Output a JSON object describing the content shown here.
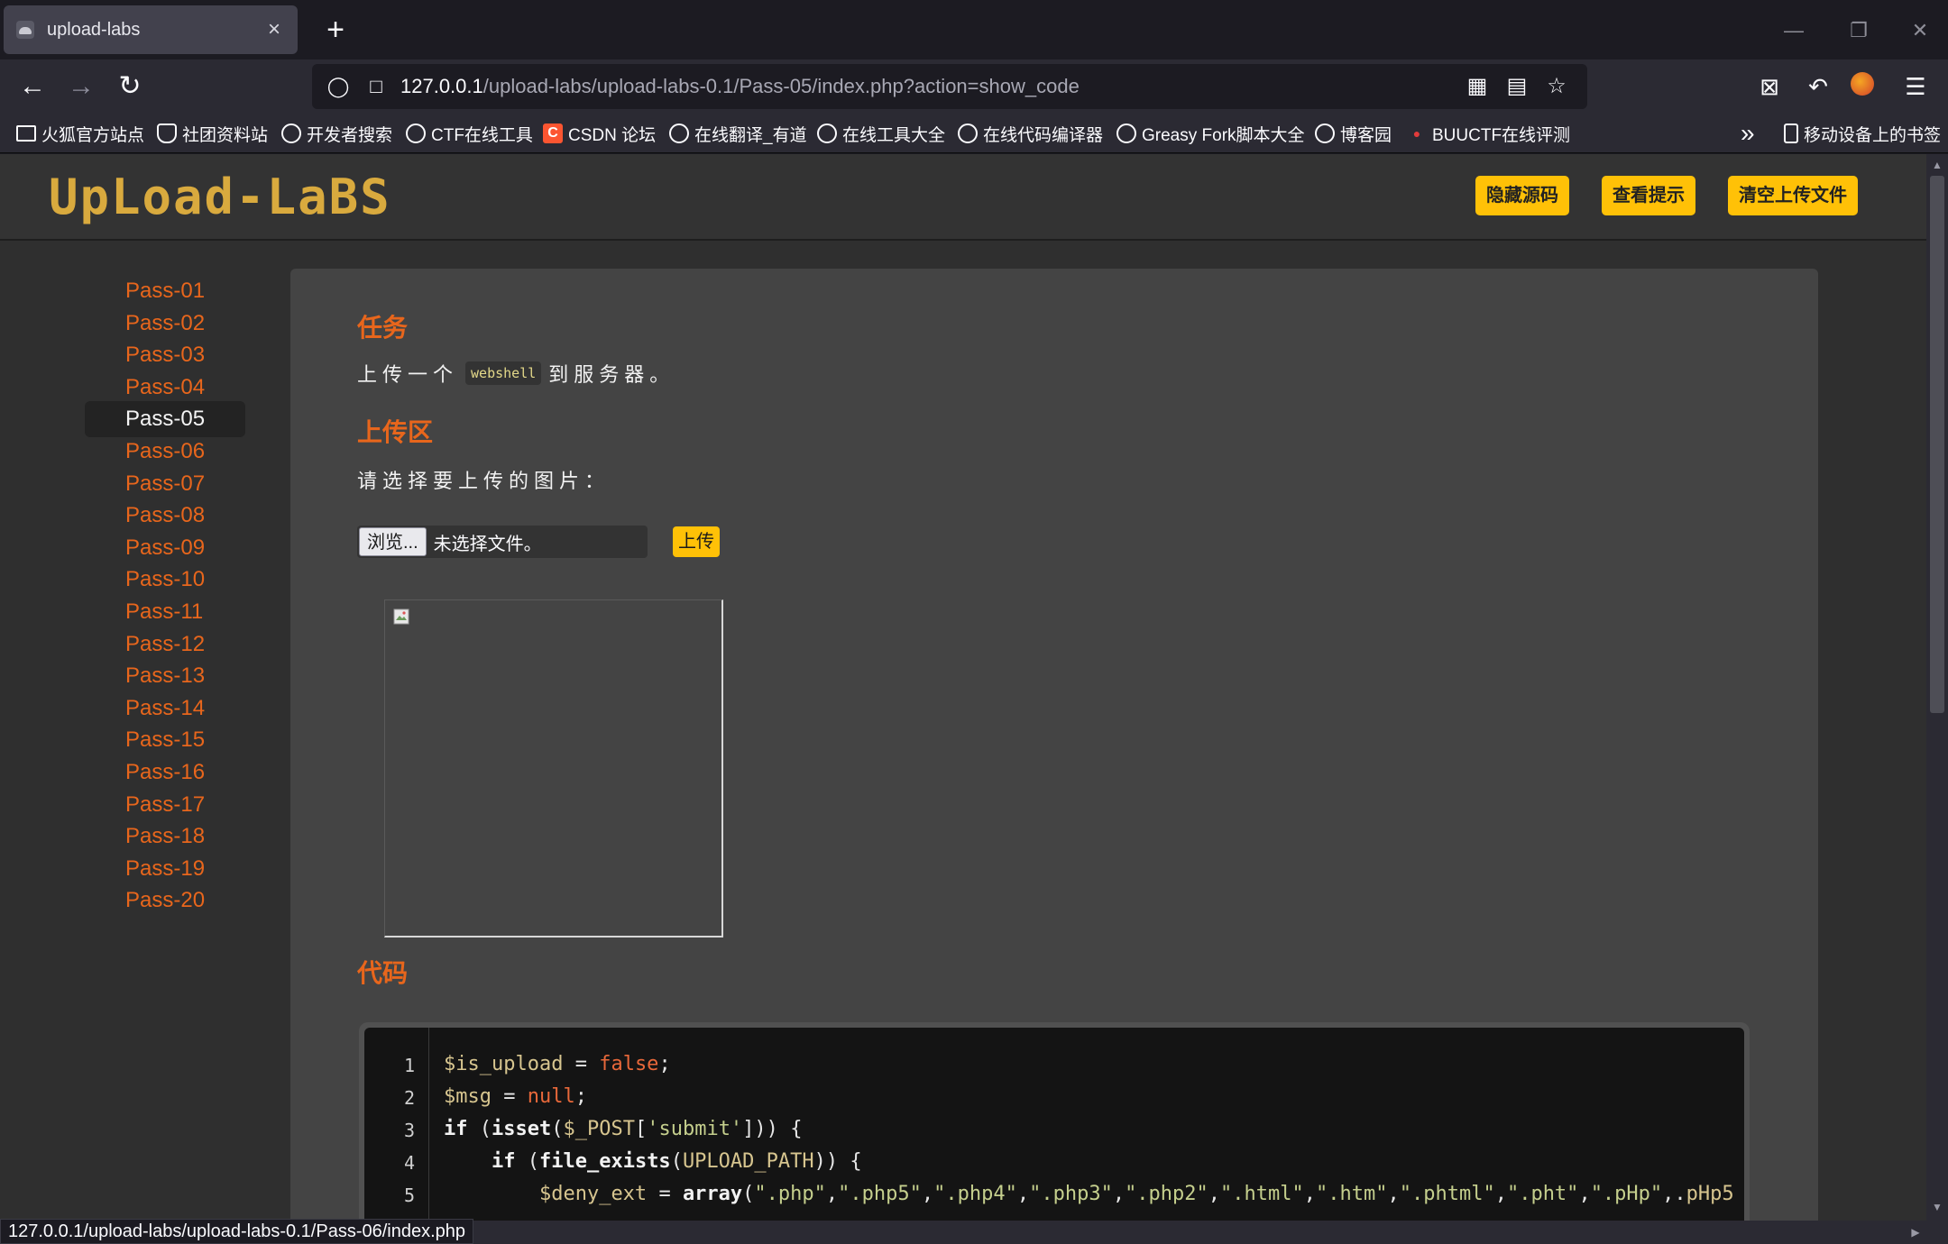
{
  "browser": {
    "tab_title": "upload-labs",
    "tab_close": "×",
    "new_tab": "+",
    "url_host": "127.0.0.1",
    "url_path": "/upload-labs/upload-labs-0.1/Pass-05/index.php?action=show_code",
    "status_url": "127.0.0.1/upload-labs/upload-labs-0.1/Pass-06/index.php"
  },
  "bookmarks": [
    "火狐官方站点",
    "社团资料站",
    "开发者搜索",
    "CTF在线工具",
    "CSDN 论坛",
    "在线翻译_有道",
    "在线工具大全",
    "在线代码编译器",
    "Greasy Fork脚本大全",
    "博客园",
    "BUUCTF在线评测"
  ],
  "bookmarks_overflow": "»",
  "mobile_bookmarks": "移动设备上的书签",
  "site": {
    "logo": "UpLoad-LaBS",
    "buttons": {
      "hide_source": "隐藏源码",
      "show_hint": "查看提示",
      "clear_uploads": "清空上传文件"
    }
  },
  "sidebar": {
    "active": "Pass-05",
    "items": [
      "Pass-01",
      "Pass-02",
      "Pass-03",
      "Pass-04",
      "Pass-05",
      "Pass-06",
      "Pass-07",
      "Pass-08",
      "Pass-09",
      "Pass-10",
      "Pass-11",
      "Pass-12",
      "Pass-13",
      "Pass-14",
      "Pass-15",
      "Pass-16",
      "Pass-17",
      "Pass-18",
      "Pass-19",
      "Pass-20"
    ]
  },
  "task": {
    "heading": "任务",
    "text_before": "上传一个",
    "code_word": "webshell",
    "text_after": "到服务器。"
  },
  "upload": {
    "heading": "上传区",
    "prompt": "请选择要上传的图片：",
    "browse_label": "浏览...",
    "file_status": "未选择文件。",
    "submit_label": "上传"
  },
  "code": {
    "heading": "代码",
    "line_numbers": [
      "1",
      "2",
      "3",
      "4",
      "5"
    ],
    "lines": [
      "$is_upload = false;",
      "$msg = null;",
      "if (isset($_POST['submit'])) {",
      "    if (file_exists(UPLOAD_PATH)) {",
      "        $deny_ext = array(\".php\",\".php5\",\".php4\",\".php3\",\".php2\",\".html\",\".htm\",\".phtml\",\".pht\",\".pHp\",\".pHp5"
    ]
  }
}
